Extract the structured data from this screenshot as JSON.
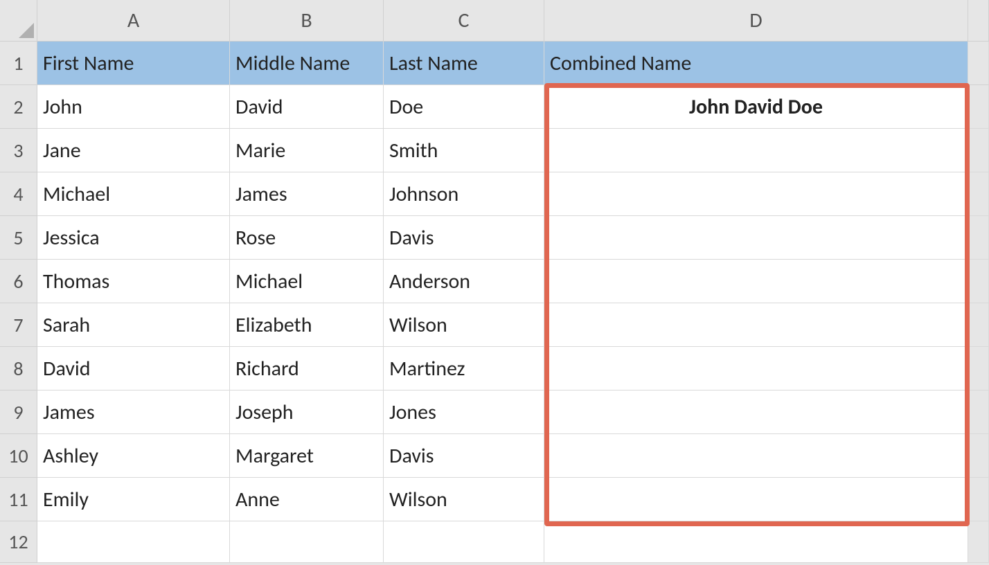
{
  "columns": {
    "A": "A",
    "B": "B",
    "C": "C",
    "D": "D"
  },
  "rowNumbers": [
    "1",
    "2",
    "3",
    "4",
    "5",
    "6",
    "7",
    "8",
    "9",
    "10",
    "11",
    "12"
  ],
  "headers": {
    "A": "First Name",
    "B": "Middle Name",
    "C": "Last Name",
    "D": "Combined Name"
  },
  "rows": [
    {
      "first": "John",
      "middle": "David",
      "last": "Doe",
      "combined": "John David Doe"
    },
    {
      "first": "Jane",
      "middle": "Marie",
      "last": "Smith",
      "combined": ""
    },
    {
      "first": "Michael",
      "middle": "James",
      "last": "Johnson",
      "combined": ""
    },
    {
      "first": "Jessica",
      "middle": "Rose",
      "last": "Davis",
      "combined": ""
    },
    {
      "first": "Thomas",
      "middle": "Michael",
      "last": "Anderson",
      "combined": ""
    },
    {
      "first": "Sarah",
      "middle": "Elizabeth",
      "last": "Wilson",
      "combined": ""
    },
    {
      "first": "David",
      "middle": "Richard",
      "last": "Martinez",
      "combined": ""
    },
    {
      "first": "James",
      "middle": "Joseph",
      "last": "Jones",
      "combined": ""
    },
    {
      "first": "Ashley",
      "middle": "Margaret",
      "last": "Davis",
      "combined": ""
    },
    {
      "first": "Emily",
      "middle": "Anne",
      "last": "Wilson",
      "combined": ""
    }
  ]
}
